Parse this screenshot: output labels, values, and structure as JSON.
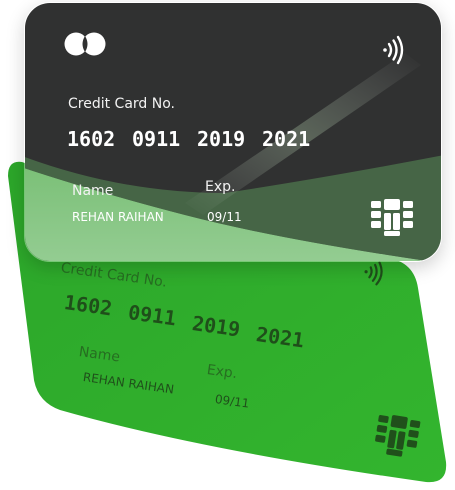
{
  "front_card": {
    "label_number": "Credit Card No.",
    "number_groups": [
      "1602",
      "0911",
      "2019",
      "2021"
    ],
    "label_name": "Name",
    "label_exp": "Exp.",
    "holder": "REHAN RAIHAN",
    "expiry": "09/11",
    "colors": {
      "body": "#303131",
      "text": "#ffffff"
    }
  },
  "back_card": {
    "label_number": "Credit Card No.",
    "number_groups": [
      "1602",
      "0911",
      "2019",
      "2021"
    ],
    "label_name": "Name",
    "label_exp": "Exp.",
    "holder": "REHAN RAIHAN",
    "expiry": "09/11",
    "colors": {
      "body": "#2fb32b",
      "text": "#1d3f18"
    }
  },
  "icons": [
    "brand-logo-icon",
    "contactless-icon",
    "chip-icon"
  ]
}
